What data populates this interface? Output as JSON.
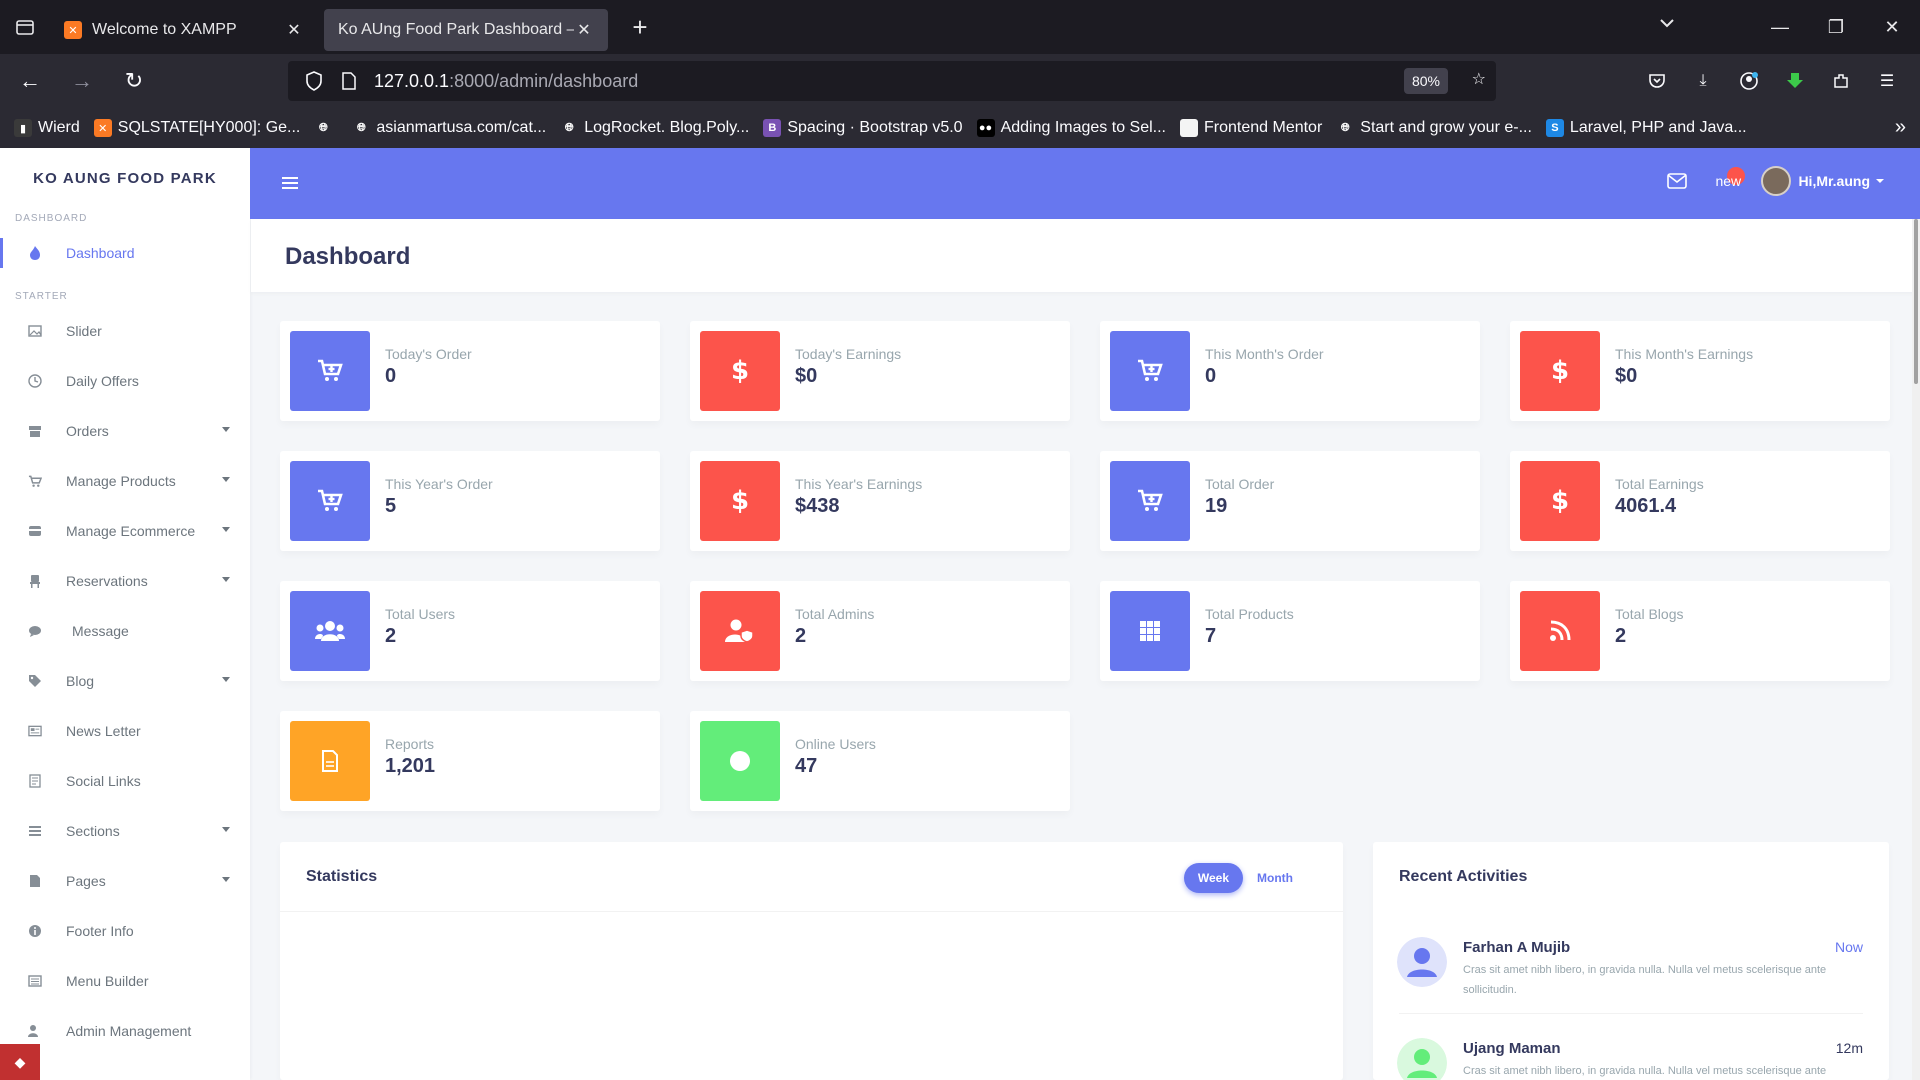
{
  "browser": {
    "tabs": [
      {
        "title": "Welcome to XAMPP",
        "active": false
      },
      {
        "title": "Ko AUng Food Park Dashboard — S",
        "active": true
      }
    ],
    "url_host": "127.0.0.1",
    "url_path": ":8000/admin/dashboard",
    "zoom": "80%",
    "bookmarks": [
      {
        "label": "Wierd",
        "icon": "bookmark-icon",
        "color": "#3a3a3a"
      },
      {
        "label": "SQLSTATE[HY000]: Ge...",
        "icon": "xampp-icon",
        "color": "#fb7a24"
      },
      {
        "label": "",
        "icon": "globe-icon",
        "color": "#2b2a33"
      },
      {
        "label": "asianmartusa.com/cat...",
        "icon": "globe-icon",
        "color": "#2b2a33"
      },
      {
        "label": "LogRocket. Blog.Poly...",
        "icon": "globe-icon",
        "color": "#2b2a33"
      },
      {
        "label": "Spacing · Bootstrap v5.0",
        "icon": "bootstrap-icon",
        "color": "#7952b3"
      },
      {
        "label": "Adding Images to Sel...",
        "icon": "medium-icon",
        "color": "#000000"
      },
      {
        "label": "Frontend Mentor",
        "icon": "page-icon",
        "color": "#f4f4f4"
      },
      {
        "label": "Start and grow your e-...",
        "icon": "globe-icon",
        "color": "#2b2a33"
      },
      {
        "label": "Laravel, PHP and Java...",
        "icon": "s-icon",
        "color": "#1e88e5"
      }
    ]
  },
  "sidebar": {
    "brand": "KO AUNG FOOD PARK",
    "header_dashboard": "DASHBOARD",
    "header_starter": "STARTER",
    "active_item": "Dashboard",
    "items": [
      {
        "label": "Slider",
        "icon": "image-icon",
        "has_caret": false
      },
      {
        "label": "Daily Offers",
        "icon": "clock-icon",
        "has_caret": false
      },
      {
        "label": "Orders",
        "icon": "box-icon",
        "has_caret": true
      },
      {
        "label": "Manage Products",
        "icon": "cart-icon",
        "has_caret": true
      },
      {
        "label": "Manage Ecommerce",
        "icon": "wallet-icon",
        "has_caret": true
      },
      {
        "label": "Reservations",
        "icon": "chair-icon",
        "has_caret": true
      },
      {
        "label": "Message",
        "icon": "chat-icon",
        "has_caret": false
      },
      {
        "label": "Blog",
        "icon": "tags-icon",
        "has_caret": true
      },
      {
        "label": "News Letter",
        "icon": "newspaper-icon",
        "has_caret": false
      },
      {
        "label": "Social Links",
        "icon": "link-icon",
        "has_caret": false
      },
      {
        "label": "Sections",
        "icon": "list-icon",
        "has_caret": true
      },
      {
        "label": "Pages",
        "icon": "file-icon",
        "has_caret": true
      },
      {
        "label": "Footer Info",
        "icon": "info-icon",
        "has_caret": false
      },
      {
        "label": "Menu Builder",
        "icon": "menu-list-icon",
        "has_caret": false
      },
      {
        "label": "Admin Management",
        "icon": "user-shield-icon",
        "has_caret": false
      }
    ]
  },
  "header": {
    "notification_badge": "new",
    "user_greeting": "Hi,Mr.aung"
  },
  "page_title": "Dashboard",
  "stats": [
    {
      "title": "Today's Order",
      "value": "0",
      "icon": "cart-plus-icon",
      "color": "#6777ef"
    },
    {
      "title": "Today's Earnings",
      "value": "$0",
      "icon": "dollar-icon",
      "color": "#fc544b"
    },
    {
      "title": "This Month's Order",
      "value": "0",
      "icon": "cart-plus-icon",
      "color": "#6777ef"
    },
    {
      "title": "This Month's Earnings",
      "value": "$0",
      "icon": "dollar-icon",
      "color": "#fc544b"
    },
    {
      "title": "This Year's Order",
      "value": "5",
      "icon": "cart-plus-icon",
      "color": "#6777ef"
    },
    {
      "title": "This Year's Earnings",
      "value": "$438",
      "icon": "dollar-icon",
      "color": "#fc544b"
    },
    {
      "title": "Total Order",
      "value": "19",
      "icon": "cart-plus-icon",
      "color": "#6777ef"
    },
    {
      "title": "Total Earnings",
      "value": "4061.4",
      "icon": "dollar-icon",
      "color": "#fc544b"
    },
    {
      "title": "Total Users",
      "value": "2",
      "icon": "users-icon",
      "color": "#6777ef"
    },
    {
      "title": "Total Admins",
      "value": "2",
      "icon": "user-shield-icon",
      "color": "#fc544b"
    },
    {
      "title": "Total Products",
      "value": "7",
      "icon": "grid-icon",
      "color": "#6777ef"
    },
    {
      "title": "Total Blogs",
      "value": "2",
      "icon": "rss-icon",
      "color": "#fc544b"
    },
    {
      "title": "Reports",
      "value": "1,201",
      "icon": "file-icon",
      "color": "#ffa426"
    },
    {
      "title": "Online Users",
      "value": "47",
      "icon": "circle-icon",
      "color": "#63ed7a"
    }
  ],
  "statistics": {
    "title": "Statistics",
    "tabs": [
      "Week",
      "Month"
    ],
    "active_tab": "Week"
  },
  "recent_activities": {
    "title": "Recent Activities",
    "items": [
      {
        "name": "Farhan A Mujib",
        "time": "Now",
        "time_color": "#6777ef",
        "text": "Cras sit amet nibh libero, in gravida nulla. Nulla vel metus scelerisque ante sollicitudin.",
        "avatar_color": "#6777ef"
      },
      {
        "name": "Ujang Maman",
        "time": "12m",
        "time_color": "#34395e",
        "text": "Cras sit amet nibh libero, in gravida nulla. Nulla vel metus scelerisque ante",
        "avatar_color": "#63ed7a"
      }
    ]
  }
}
